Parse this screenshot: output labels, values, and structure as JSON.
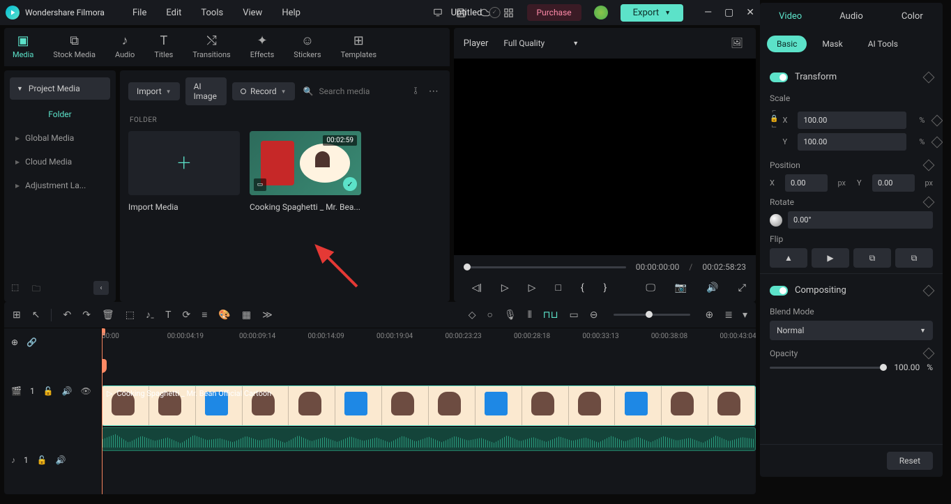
{
  "app": {
    "name": "Wondershare Filmora",
    "document": "Untitled"
  },
  "menu": [
    "File",
    "Edit",
    "Tools",
    "View",
    "Help"
  ],
  "actions": {
    "purchase": "Purchase",
    "export": "Export"
  },
  "nav": [
    {
      "label": "Media",
      "active": true
    },
    {
      "label": "Stock Media"
    },
    {
      "label": "Audio"
    },
    {
      "label": "Titles"
    },
    {
      "label": "Transitions"
    },
    {
      "label": "Effects"
    },
    {
      "label": "Stickers"
    },
    {
      "label": "Templates"
    }
  ],
  "sidebar": {
    "project_btn": "Project Media",
    "folder_tab": "Folder",
    "items": [
      "Global Media",
      "Cloud Media",
      "Adjustment La..."
    ]
  },
  "content": {
    "import_label": "Import",
    "ai_image": "AI Image",
    "record": "Record",
    "search_placeholder": "Search media",
    "folder_heading": "FOLDER",
    "card_import": "Import Media",
    "clip": {
      "duration": "00:02:59",
      "name": "Cooking Spaghetti _ Mr. Bea..."
    }
  },
  "player": {
    "label": "Player",
    "quality": "Full Quality",
    "current_tc": "00:00:00:00",
    "total_tc": "00:02:58:23"
  },
  "inspector": {
    "tabs": [
      "Video",
      "Audio",
      "Color"
    ],
    "subtabs": [
      "Basic",
      "Mask",
      "AI Tools"
    ],
    "transform": "Transform",
    "scale": "Scale",
    "scale_x": "100.00",
    "scale_y": "100.00",
    "pct": "%",
    "position": "Position",
    "pos_x": "0.00",
    "pos_y": "0.00",
    "px": "px",
    "rotate": "Rotate",
    "rotate_val": "0.00°",
    "flip": "Flip",
    "compositing": "Compositing",
    "blend": "Blend Mode",
    "blend_val": "Normal",
    "opacity": "Opacity",
    "opacity_val": "100.00",
    "reset": "Reset",
    "x": "X",
    "y": "Y"
  },
  "ruler": [
    "00:00",
    "00:00:04:19",
    "00:00:09:14",
    "00:00:14:09",
    "00:00:19:04",
    "00:00:23:23",
    "00:00:28:18",
    "00:00:33:13",
    "00:00:38:08",
    "00:00:43:04"
  ],
  "timeline_clip": "Cooking Spaghetti _ Mr. Bean Official Cartoon",
  "track_v": "1",
  "track_a": "1"
}
